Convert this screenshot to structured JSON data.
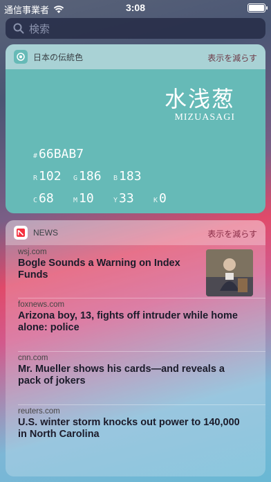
{
  "status_bar": {
    "carrier": "通信事業者",
    "time": "3:08"
  },
  "search": {
    "placeholder": "検索"
  },
  "color_widget": {
    "app_name": "日本の伝統色",
    "show_less": "表示を減らす",
    "color_name_kanji": "水浅葱",
    "color_name_romaji": "MIZUASAGI",
    "hex": "66BAB7",
    "rgb": {
      "r": "102",
      "g": "186",
      "b": "183"
    },
    "cmyk": {
      "c": "68",
      "m": "10",
      "y": "33",
      "k": "0"
    },
    "color": "#66BAB7"
  },
  "news_widget": {
    "app_name": "NEWS",
    "show_less": "表示を減らす",
    "items": [
      {
        "source": "wsj.com",
        "title": "Bogle Sounds a Warning on Index Funds"
      },
      {
        "source": "foxnews.com",
        "title": "Arizona boy, 13, fights off intruder while home alone: police"
      },
      {
        "source": "cnn.com",
        "title": "Mr. Mueller shows his cards—and reveals a pack of jokers"
      },
      {
        "source": "reuters.com",
        "title": "U.S. winter storm knocks out power to 140,000 in North Carolina"
      }
    ]
  }
}
